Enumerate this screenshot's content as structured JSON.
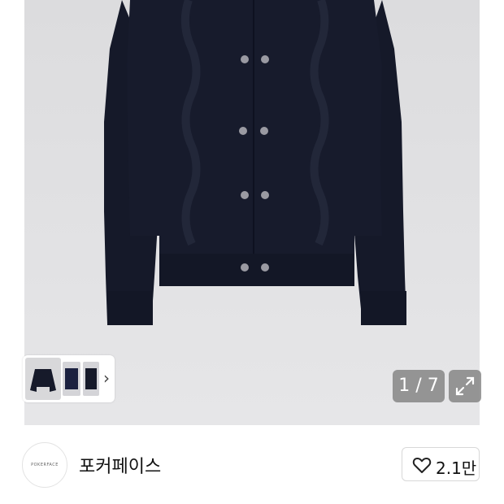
{
  "gallery": {
    "counter": "1 / 7",
    "thumb_arrow": "›",
    "photo_alt": "navy cardigan product photo",
    "colors": {
      "background": "#e0e0e2",
      "garment": "#161a2a",
      "button": "#9a9aa2"
    }
  },
  "brand": {
    "logo_text": "POKERFACE",
    "name": "포커페이스"
  },
  "like": {
    "count": "2.1만"
  }
}
